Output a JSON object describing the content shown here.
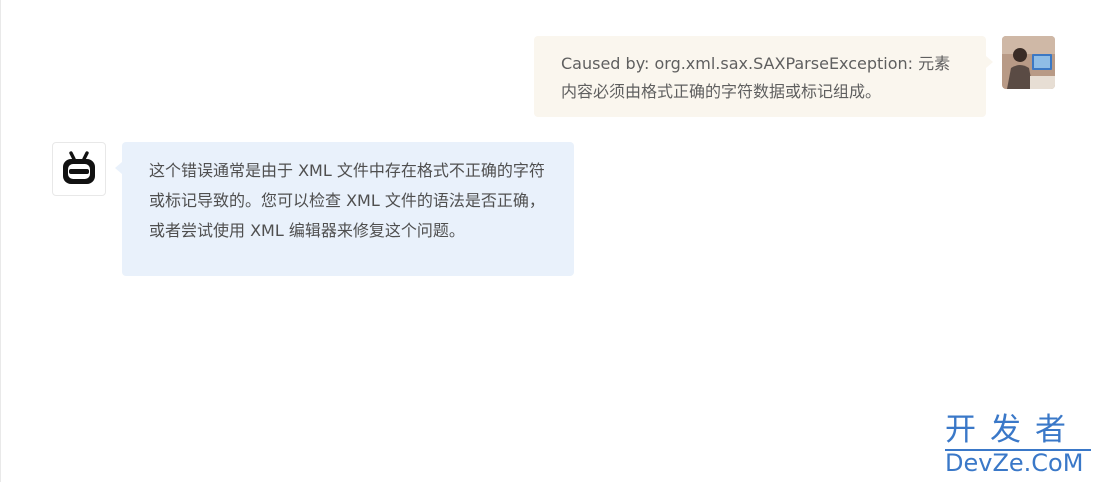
{
  "conversation": {
    "user_message": {
      "text": "Caused by: org.xml.sax.SAXParseException: 元素内容必须由格式正确的字符数据或标记组成。",
      "avatar_icon": "user-photo-avatar"
    },
    "bot_message": {
      "text": "这个错误通常是由于 XML 文件中存在格式不正确的字符或标记导致的。您可以检查 XML 文件的语法是否正确，或者尝试使用 XML 编辑器来修复这个问题。",
      "avatar_icon": "robot-icon"
    }
  },
  "watermark": {
    "top": "开发者",
    "bottom": "DevZe.CoM"
  },
  "colors": {
    "user_bubble": "#faf6ee",
    "bot_bubble": "#e9f1fb",
    "watermark": "#3a78c8"
  }
}
